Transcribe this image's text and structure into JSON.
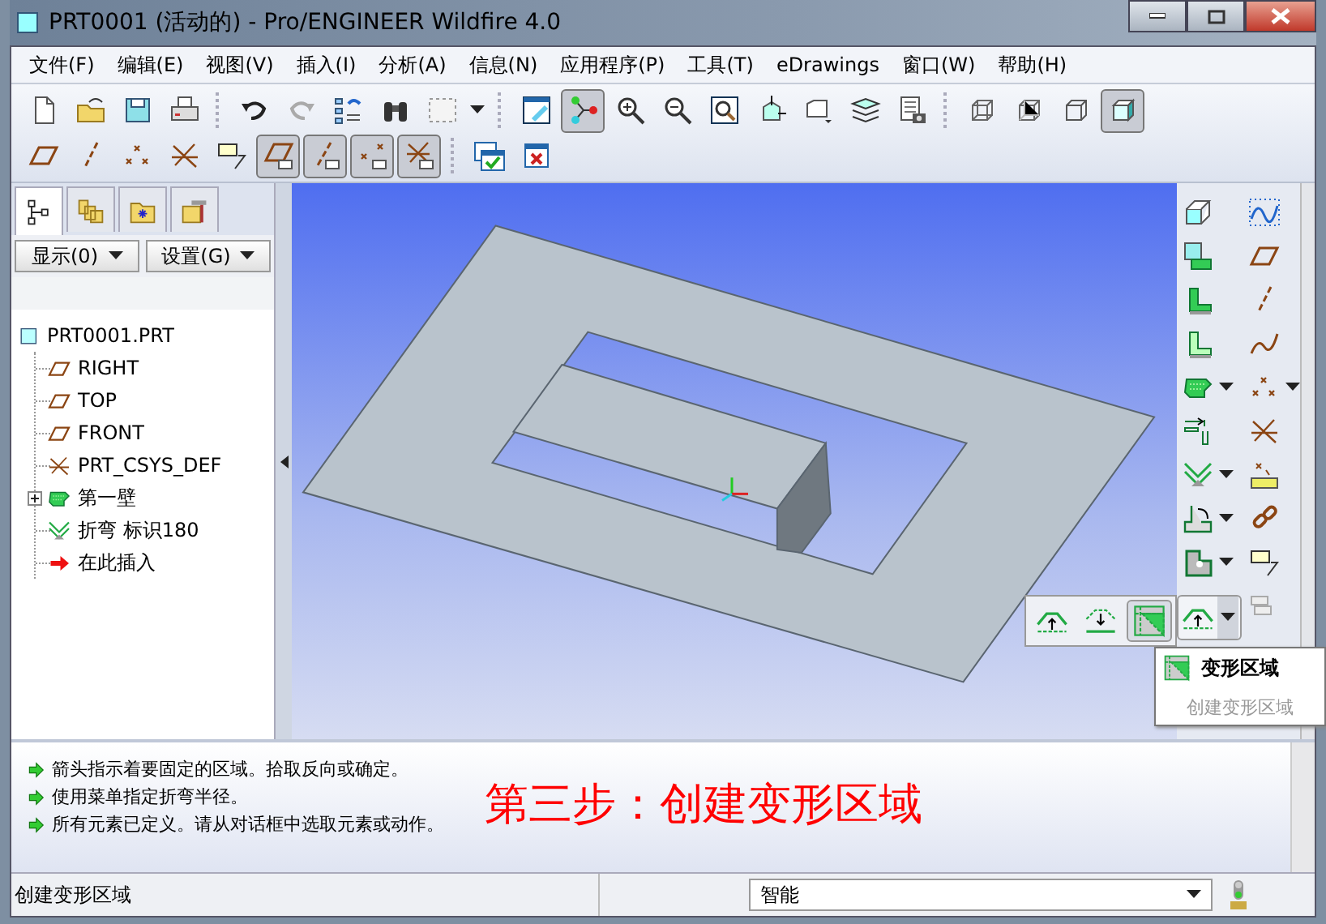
{
  "window": {
    "title": "PRT0001 (活动的) - Pro/ENGINEER Wildfire 4.0"
  },
  "menu": [
    "文件(F)",
    "编辑(E)",
    "视图(V)",
    "插入(I)",
    "分析(A)",
    "信息(N)",
    "应用程序(P)",
    "工具(T)",
    "eDrawings",
    "窗口(W)",
    "帮助(H)"
  ],
  "toolbar_rows": [
    [
      {
        "kind": "new",
        "selected": false
      },
      {
        "kind": "open",
        "selected": false
      },
      {
        "kind": "save",
        "selected": false
      },
      {
        "kind": "print",
        "selected": false
      },
      {
        "kind": "sep"
      },
      {
        "kind": "undo",
        "selected": false
      },
      {
        "kind": "redo",
        "selected": false
      },
      {
        "kind": "regen",
        "selected": false
      },
      {
        "kind": "find",
        "selected": false
      },
      {
        "kind": "selbox",
        "selected": false
      },
      {
        "kind": "caret"
      },
      {
        "kind": "sep"
      },
      {
        "kind": "repaint",
        "selected": false
      },
      {
        "kind": "spin",
        "selected": true
      },
      {
        "kind": "zoomin",
        "selected": false
      },
      {
        "kind": "zoomout",
        "selected": false
      },
      {
        "kind": "zoomfit",
        "selected": false
      },
      {
        "kind": "reorient",
        "selected": false
      },
      {
        "kind": "views",
        "selected": false
      },
      {
        "kind": "layers",
        "selected": false
      },
      {
        "kind": "viewmgr",
        "selected": false
      },
      {
        "kind": "sep"
      },
      {
        "kind": "wire",
        "selected": false
      },
      {
        "kind": "hidden",
        "selected": false
      },
      {
        "kind": "nohidden",
        "selected": false
      },
      {
        "kind": "shaded",
        "selected": true
      }
    ],
    [
      {
        "kind": "dplane",
        "selected": false
      },
      {
        "kind": "daxis",
        "selected": false
      },
      {
        "kind": "dpoint",
        "selected": false
      },
      {
        "kind": "dcsys",
        "selected": false
      },
      {
        "kind": "annot",
        "selected": false
      },
      {
        "kind": "planeshow",
        "selected": true
      },
      {
        "kind": "axisshow",
        "selected": true
      },
      {
        "kind": "pointshow",
        "selected": true
      },
      {
        "kind": "csysshow",
        "selected": true
      },
      {
        "kind": "sep"
      },
      {
        "kind": "accept",
        "selected": false
      },
      {
        "kind": "close",
        "selected": false
      }
    ]
  ],
  "model_tree": {
    "tabs": [
      {
        "kind": "tree",
        "selected": true
      },
      {
        "kind": "folders",
        "selected": false
      },
      {
        "kind": "favorites",
        "selected": false
      },
      {
        "kind": "tools",
        "selected": false
      }
    ],
    "buttons": [
      "显示(0)",
      "设置(G)"
    ],
    "items": [
      {
        "kind": "part",
        "label": "PRT0001.PRT",
        "children": [
          {
            "kind": "dplane",
            "label": "RIGHT"
          },
          {
            "kind": "dplane",
            "label": "TOP"
          },
          {
            "kind": "dplane",
            "label": "FRONT"
          },
          {
            "kind": "dcsys",
            "label": "PRT_CSYS_DEF"
          },
          {
            "kind": "wall",
            "label": "第一壁",
            "expanded": false
          },
          {
            "kind": "bend",
            "label": "折弯 标识180"
          },
          {
            "kind": "insert",
            "label": "在此插入"
          }
        ]
      }
    ]
  },
  "feature_toolbar": [
    [
      {
        "kind": "extrude",
        "dropdown": false
      },
      {
        "kind": "flat",
        "dropdown": false
      },
      {
        "kind": "flange",
        "dropdown": false
      },
      {
        "kind": "flange2",
        "dropdown": false
      },
      {
        "kind": "wall",
        "dropdown": true
      },
      {
        "kind": "rip",
        "dropdown": false
      },
      {
        "kind": "bend",
        "dropdown": true
      },
      {
        "kind": "unbend",
        "dropdown": true
      },
      {
        "kind": "corner",
        "dropdown": true
      }
    ],
    [
      {
        "kind": "sketch",
        "dropdown": false
      },
      {
        "kind": "dplane",
        "dropdown": false
      },
      {
        "kind": "daxis",
        "dropdown": false
      },
      {
        "kind": "curve",
        "dropdown": false
      },
      {
        "kind": "dpoint",
        "dropdown": true
      },
      {
        "kind": "dcsys",
        "dropdown": false
      },
      {
        "kind": "analysis",
        "dropdown": false
      },
      {
        "kind": "chain",
        "dropdown": false
      },
      {
        "kind": "annot",
        "dropdown": false
      },
      {
        "kind": "greyed",
        "dropdown": false
      }
    ]
  ],
  "flyout": {
    "buttons": [
      {
        "kind": "bendup",
        "selected": false
      },
      {
        "kind": "benddown",
        "selected": false
      },
      {
        "kind": "deform",
        "selected": true
      }
    ],
    "current": {
      "kind": "bendup"
    },
    "tooltip": {
      "title": "变形区域",
      "description": "创建变形区域"
    }
  },
  "messages": [
    "箭头指示着要固定的区域。拾取反向或确定。",
    "使用菜单指定折弯半径。",
    "所有元素已定义。请从对话框中选取元素或动作。"
  ],
  "annotation": "第三步：创建变形区域",
  "status_bar": {
    "text": "创建变形区域",
    "filter": "智能"
  }
}
